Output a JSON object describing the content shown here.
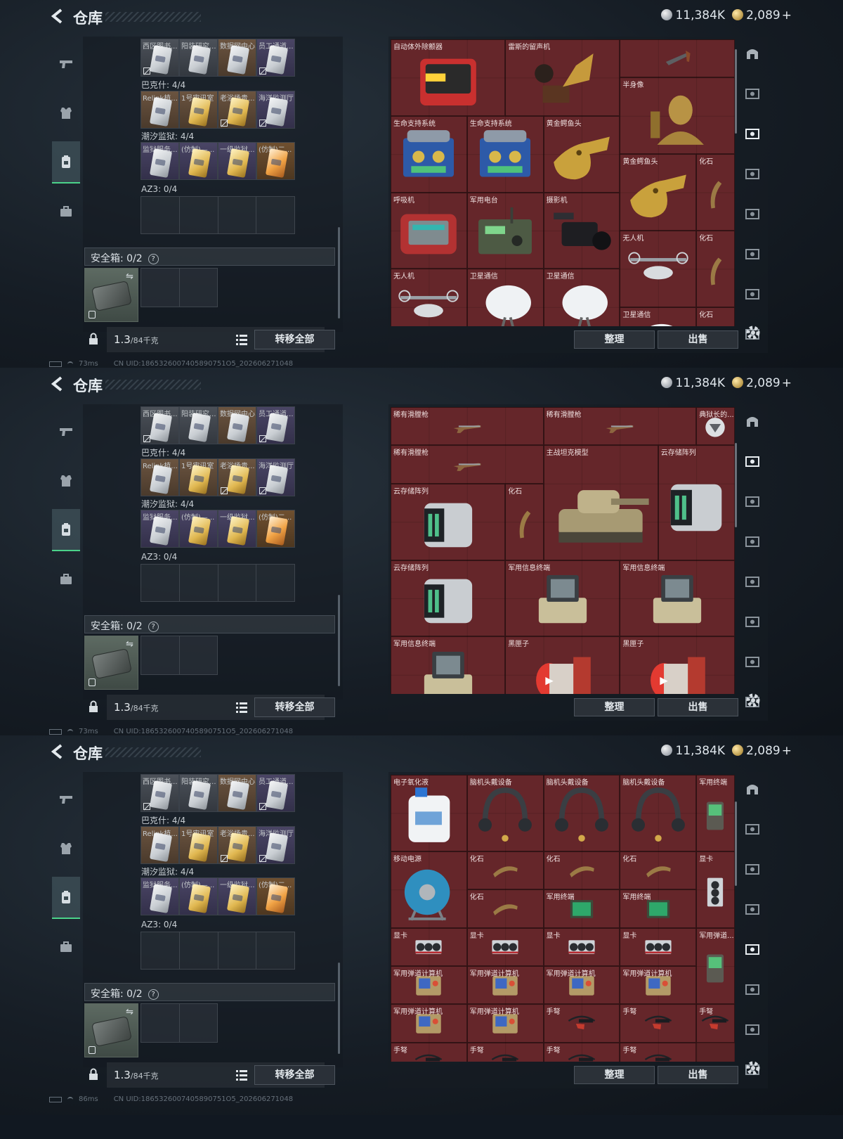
{
  "screens": [
    {
      "header": {
        "title": "仓库",
        "silver": "11,384K",
        "gold": "2,089",
        "plus": "+"
      },
      "sidebar": [
        "weapon-tab",
        "armor-tab",
        "backpack-tab",
        "case-tab"
      ],
      "card_groups": [
        {
          "label": "",
          "cards": [
            {
              "label": "西区图书...",
              "style": "gray",
              "img": "silver",
              "locked": true
            },
            {
              "label": "阳装研究...",
              "style": "gray",
              "img": "silver",
              "locked": false
            },
            {
              "label": "数据网中心...",
              "style": "brown",
              "img": "silver",
              "locked": false
            },
            {
              "label": "员工通道...",
              "style": "purple",
              "img": "silver",
              "locked": true
            }
          ]
        },
        {
          "label": "巴克什: 4/4",
          "cards": [
            {
              "label": "Relink植...",
              "style": "brown",
              "img": "silver",
              "locked": false
            },
            {
              "label": "1号审讯室",
              "style": "brown",
              "img": "gold",
              "locked": false
            },
            {
              "label": "老浴场贵...",
              "style": "brown",
              "img": "gold",
              "locked": true
            },
            {
              "label": "海洋监测厅",
              "style": "purple",
              "img": "silver",
              "locked": true
            }
          ]
        },
        {
          "label": "潮汐监狱: 4/4",
          "cards": [
            {
              "label": "监狱服务...",
              "style": "purple",
              "img": "silver",
              "locked": false
            },
            {
              "label": "(仿制)—...",
              "style": "purple",
              "img": "gold",
              "locked": false
            },
            {
              "label": "一级监狱...",
              "style": "purple",
              "img": "gold",
              "locked": false
            },
            {
              "label": "(仿制)二...",
              "style": "orange",
              "img": "orange",
              "locked": false
            }
          ]
        }
      ],
      "az3_label": "AZ3: 0/4",
      "safe_label": "安全箱: 0/2",
      "safe_help": "?",
      "weight_value": "1.3",
      "weight_capacity": "/84千克",
      "transfer_label": "转移全部",
      "sort_label": "整理",
      "sell_label": "出售",
      "status": {
        "ping": "73ms",
        "uid": "CN UID:1865326007405890751O5_202606271048"
      },
      "items": [
        {
          "label": "自动体外除颤器",
          "col": 0,
          "row": 0,
          "w": 3,
          "h": 2,
          "kind": "defib"
        },
        {
          "label": "雷斯的留声机",
          "col": 3,
          "row": 0,
          "w": 3,
          "h": 2,
          "kind": "gramophone"
        },
        {
          "label": "",
          "col": 6,
          "row": 0,
          "w": 3,
          "h": 1,
          "kind": "tool"
        },
        {
          "label": "半身像",
          "col": 6,
          "row": 1,
          "w": 3,
          "h": 2,
          "kind": "bust"
        },
        {
          "label": "生命支持系统",
          "col": 0,
          "row": 2,
          "w": 2,
          "h": 2,
          "kind": "lifesupport"
        },
        {
          "label": "生命支持系统",
          "col": 2,
          "row": 2,
          "w": 2,
          "h": 2,
          "kind": "lifesupport"
        },
        {
          "label": "黄金鳄鱼头",
          "col": 4,
          "row": 2,
          "w": 2,
          "h": 2,
          "kind": "croc"
        },
        {
          "label": "黄金鳄鱼头",
          "col": 6,
          "row": 3,
          "w": 2,
          "h": 2,
          "kind": "croc"
        },
        {
          "label": "化石",
          "col": 8,
          "row": 3,
          "w": 1,
          "h": 2,
          "kind": "claw"
        },
        {
          "label": "呼吸机",
          "col": 0,
          "row": 4,
          "w": 2,
          "h": 2,
          "kind": "ventilator"
        },
        {
          "label": "军用电台",
          "col": 2,
          "row": 4,
          "w": 2,
          "h": 2,
          "kind": "radio"
        },
        {
          "label": "摄影机",
          "col": 4,
          "row": 4,
          "w": 2,
          "h": 2,
          "kind": "camera"
        },
        {
          "label": "无人机",
          "col": 6,
          "row": 5,
          "w": 2,
          "h": 2,
          "kind": "drone"
        },
        {
          "label": "化石",
          "col": 8,
          "row": 5,
          "w": 1,
          "h": 2,
          "kind": "claw"
        },
        {
          "label": "无人机",
          "col": 0,
          "row": 6,
          "w": 2,
          "h": 2,
          "kind": "drone"
        },
        {
          "label": "卫星通信",
          "col": 2,
          "row": 6,
          "w": 2,
          "h": 2,
          "kind": "dish"
        },
        {
          "label": "卫星通信",
          "col": 4,
          "row": 6,
          "w": 2,
          "h": 2,
          "kind": "dish"
        },
        {
          "label": "卫星通信",
          "col": 6,
          "row": 7,
          "w": 2,
          "h": 2,
          "kind": "dish"
        },
        {
          "label": "化石",
          "col": 8,
          "row": 7,
          "w": 1,
          "h": 2,
          "kind": "claw"
        }
      ]
    },
    {
      "header": {
        "title": "仓库",
        "silver": "11,384K",
        "gold": "2,089",
        "plus": "+"
      },
      "sidebar": [
        "weapon-tab",
        "armor-tab",
        "backpack-tab",
        "case-tab"
      ],
      "card_groups": [
        {
          "label": "",
          "cards": [
            {
              "label": "西区图书...",
              "style": "gray",
              "img": "silver",
              "locked": true
            },
            {
              "label": "阳装研究...",
              "style": "gray",
              "img": "silver",
              "locked": false
            },
            {
              "label": "数据网中心...",
              "style": "brown",
              "img": "silver",
              "locked": false
            },
            {
              "label": "员工通道...",
              "style": "purple",
              "img": "silver",
              "locked": true
            }
          ]
        },
        {
          "label": "巴克什: 4/4",
          "cards": [
            {
              "label": "Relink植...",
              "style": "brown",
              "img": "silver",
              "locked": false
            },
            {
              "label": "1号审讯室",
              "style": "brown",
              "img": "gold",
              "locked": false
            },
            {
              "label": "老浴场贵...",
              "style": "brown",
              "img": "gold",
              "locked": true
            },
            {
              "label": "海洋监测厅",
              "style": "purple",
              "img": "silver",
              "locked": true
            }
          ]
        },
        {
          "label": "潮汐监狱: 4/4",
          "cards": [
            {
              "label": "监狱服务...",
              "style": "purple",
              "img": "silver",
              "locked": false
            },
            {
              "label": "(仿制)—...",
              "style": "purple",
              "img": "gold",
              "locked": false
            },
            {
              "label": "一级监狱...",
              "style": "purple",
              "img": "gold",
              "locked": false
            },
            {
              "label": "(仿制)二...",
              "style": "orange",
              "img": "orange",
              "locked": false
            }
          ]
        }
      ],
      "az3_label": "AZ3: 0/4",
      "safe_label": "安全箱: 0/2",
      "safe_help": "?",
      "weight_value": "1.3",
      "weight_capacity": "/84千克",
      "transfer_label": "转移全部",
      "sort_label": "整理",
      "sell_label": "出售",
      "status": {
        "ping": "73ms",
        "uid": "CN UID:1865326007405890751O5_202606271048"
      },
      "items": [
        {
          "label": "稀有滑膛枪",
          "col": 0,
          "row": 0,
          "w": 4,
          "h": 1,
          "kind": "musket"
        },
        {
          "label": "稀有滑膛枪",
          "col": 4,
          "row": 0,
          "w": 4,
          "h": 1,
          "kind": "musket"
        },
        {
          "label": "典狱长的...",
          "col": 8,
          "row": 0,
          "w": 1,
          "h": 1,
          "kind": "badge"
        },
        {
          "label": "稀有滑膛枪",
          "col": 0,
          "row": 1,
          "w": 4,
          "h": 1,
          "kind": "musket"
        },
        {
          "label": "主战坦克模型",
          "col": 4,
          "row": 1,
          "w": 3,
          "h": 3,
          "kind": "tank"
        },
        {
          "label": "云存储阵列",
          "col": 7,
          "row": 1,
          "w": 2,
          "h": 3,
          "kind": "server"
        },
        {
          "label": "云存储阵列",
          "col": 0,
          "row": 2,
          "w": 3,
          "h": 2,
          "kind": "server"
        },
        {
          "label": "化石",
          "col": 3,
          "row": 2,
          "w": 1,
          "h": 2,
          "kind": "claw"
        },
        {
          "label": "云存储阵列",
          "col": 0,
          "row": 4,
          "w": 3,
          "h": 2,
          "kind": "server"
        },
        {
          "label": "军用信息终端",
          "col": 3,
          "row": 4,
          "w": 3,
          "h": 2,
          "kind": "terminal"
        },
        {
          "label": "军用信息终端",
          "col": 6,
          "row": 4,
          "w": 3,
          "h": 2,
          "kind": "terminal"
        },
        {
          "label": "军用信息终端",
          "col": 0,
          "row": 6,
          "w": 3,
          "h": 2,
          "kind": "terminal"
        },
        {
          "label": "黑匣子",
          "col": 3,
          "row": 6,
          "w": 3,
          "h": 2,
          "kind": "blackbox"
        },
        {
          "label": "黑匣子",
          "col": 6,
          "row": 6,
          "w": 3,
          "h": 2,
          "kind": "blackbox"
        }
      ]
    },
    {
      "header": {
        "title": "仓库",
        "silver": "11,384K",
        "gold": "2,089",
        "plus": "+"
      },
      "sidebar": [
        "weapon-tab",
        "armor-tab",
        "backpack-tab",
        "case-tab"
      ],
      "card_groups": [
        {
          "label": "",
          "cards": [
            {
              "label": "西区图书...",
              "style": "gray",
              "img": "silver",
              "locked": true
            },
            {
              "label": "阳装研究...",
              "style": "gray",
              "img": "silver",
              "locked": false
            },
            {
              "label": "数据网中心...",
              "style": "brown",
              "img": "silver",
              "locked": false
            },
            {
              "label": "员工通道...",
              "style": "purple",
              "img": "silver",
              "locked": true
            }
          ]
        },
        {
          "label": "巴克什: 4/4",
          "cards": [
            {
              "label": "Relink植...",
              "style": "brown",
              "img": "silver",
              "locked": false
            },
            {
              "label": "1号审讯室",
              "style": "brown",
              "img": "gold",
              "locked": false
            },
            {
              "label": "老浴场贵...",
              "style": "brown",
              "img": "gold",
              "locked": true
            },
            {
              "label": "海洋监测厅",
              "style": "purple",
              "img": "silver",
              "locked": true
            }
          ]
        },
        {
          "label": "潮汐监狱: 4/4",
          "cards": [
            {
              "label": "监狱服务...",
              "style": "purple",
              "img": "silver",
              "locked": false
            },
            {
              "label": "(仿制)—...",
              "style": "purple",
              "img": "gold",
              "locked": false
            },
            {
              "label": "一级监狱...",
              "style": "purple",
              "img": "gold",
              "locked": false
            },
            {
              "label": "(仿制)二...",
              "style": "orange",
              "img": "orange",
              "locked": false
            }
          ]
        }
      ],
      "az3_label": "AZ3: 0/4",
      "safe_label": "安全箱: 0/2",
      "safe_help": "?",
      "weight_value": "1.3",
      "weight_capacity": "/84千克",
      "transfer_label": "转移全部",
      "sort_label": "整理",
      "sell_label": "出售",
      "status": {
        "ping": "86ms",
        "uid": "CN UID:1865326007405890751O5_202606271048"
      },
      "items": [
        {
          "label": "电子氧化液",
          "col": 0,
          "row": 0,
          "w": 2,
          "h": 2,
          "kind": "jug"
        },
        {
          "label": "脑机头戴设备",
          "col": 2,
          "row": 0,
          "w": 2,
          "h": 2,
          "kind": "headset"
        },
        {
          "label": "脑机头戴设备",
          "col": 4,
          "row": 0,
          "w": 2,
          "h": 2,
          "kind": "headset"
        },
        {
          "label": "脑机头戴设备",
          "col": 6,
          "row": 0,
          "w": 2,
          "h": 2,
          "kind": "headset"
        },
        {
          "label": "军用终端",
          "col": 8,
          "row": 0,
          "w": 1,
          "h": 2,
          "kind": "phone"
        },
        {
          "label": "移动电源",
          "col": 0,
          "row": 2,
          "w": 2,
          "h": 2,
          "kind": "reel"
        },
        {
          "label": "化石",
          "col": 2,
          "row": 2,
          "w": 2,
          "h": 1,
          "kind": "clawh"
        },
        {
          "label": "化石",
          "col": 4,
          "row": 2,
          "w": 2,
          "h": 1,
          "kind": "clawh"
        },
        {
          "label": "化石",
          "col": 6,
          "row": 2,
          "w": 2,
          "h": 1,
          "kind": "clawh"
        },
        {
          "label": "显卡",
          "col": 8,
          "row": 2,
          "w": 1,
          "h": 2,
          "kind": "gpuv"
        },
        {
          "label": "化石",
          "col": 2,
          "row": 3,
          "w": 2,
          "h": 1,
          "kind": "clawh"
        },
        {
          "label": "军用终端",
          "col": 4,
          "row": 3,
          "w": 2,
          "h": 1,
          "kind": "pcb"
        },
        {
          "label": "军用终端",
          "col": 6,
          "row": 3,
          "w": 2,
          "h": 1,
          "kind": "pcb"
        },
        {
          "label": "显卡",
          "col": 0,
          "row": 4,
          "w": 2,
          "h": 1,
          "kind": "gpu"
        },
        {
          "label": "显卡",
          "col": 2,
          "row": 4,
          "w": 2,
          "h": 1,
          "kind": "gpu"
        },
        {
          "label": "显卡",
          "col": 4,
          "row": 4,
          "w": 2,
          "h": 1,
          "kind": "gpu"
        },
        {
          "label": "显卡",
          "col": 6,
          "row": 4,
          "w": 2,
          "h": 1,
          "kind": "gpu"
        },
        {
          "label": "军用弹道...",
          "col": 8,
          "row": 4,
          "w": 1,
          "h": 2,
          "kind": "phone"
        },
        {
          "label": "军用弹道计算机",
          "col": 0,
          "row": 5,
          "w": 2,
          "h": 1,
          "kind": "ballistic"
        },
        {
          "label": "军用弹道计算机",
          "col": 2,
          "row": 5,
          "w": 2,
          "h": 1,
          "kind": "ballistic"
        },
        {
          "label": "军用弹道计算机",
          "col": 4,
          "row": 5,
          "w": 2,
          "h": 1,
          "kind": "ballistic"
        },
        {
          "label": "军用弹道计算机",
          "col": 6,
          "row": 5,
          "w": 2,
          "h": 1,
          "kind": "ballistic"
        },
        {
          "label": "军用弹道计算机",
          "col": 0,
          "row": 6,
          "w": 2,
          "h": 1,
          "kind": "ballistic"
        },
        {
          "label": "军用弹道计算机",
          "col": 2,
          "row": 6,
          "w": 2,
          "h": 1,
          "kind": "ballistic"
        },
        {
          "label": "手弩",
          "col": 4,
          "row": 6,
          "w": 2,
          "h": 1,
          "kind": "crossbow"
        },
        {
          "label": "手弩",
          "col": 6,
          "row": 6,
          "w": 2,
          "h": 1,
          "kind": "crossbow"
        },
        {
          "label": "手弩",
          "col": 8,
          "row": 6,
          "w": 1,
          "h": 1,
          "kind": "crossbow"
        },
        {
          "label": "手弩",
          "col": 0,
          "row": 7,
          "w": 2,
          "h": 1,
          "kind": "crossbow"
        },
        {
          "label": "手弩",
          "col": 2,
          "row": 7,
          "w": 2,
          "h": 1,
          "kind": "crossbow"
        },
        {
          "label": "手弩",
          "col": 4,
          "row": 7,
          "w": 2,
          "h": 1,
          "kind": "crossbow"
        },
        {
          "label": "手弩",
          "col": 6,
          "row": 7,
          "w": 2,
          "h": 1,
          "kind": "crossbow"
        }
      ]
    }
  ],
  "colors": {
    "grid_bg": "#5a2326",
    "accent_green": "#4bd38a",
    "text": "#e3e8ec"
  }
}
